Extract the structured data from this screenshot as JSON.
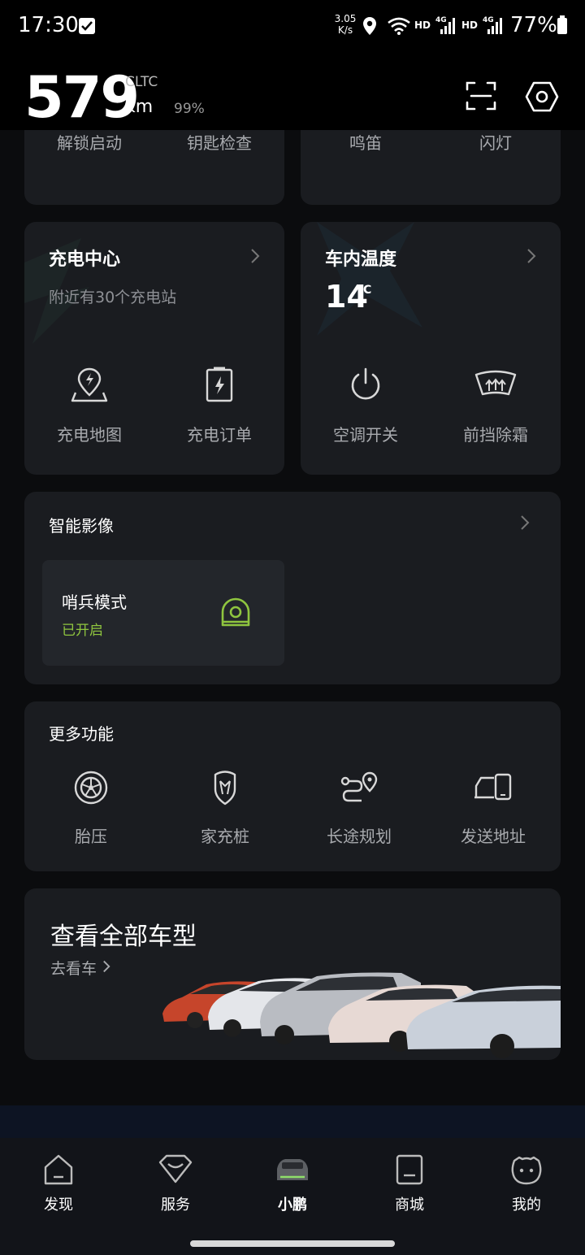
{
  "status": {
    "time": "17:30",
    "net_speed_value": "3.05",
    "net_speed_unit": "K/s",
    "hd_1": "HD",
    "net_1": "4G",
    "hd_2": "HD",
    "net_2": "4G",
    "battery": "77%"
  },
  "header": {
    "range_value": "579",
    "range_standard": "CLTC",
    "range_unit": "km",
    "battery_percent": "99%"
  },
  "quick_controls": {
    "left": [
      "解锁启动",
      "钥匙检查"
    ],
    "right": [
      "鸣笛",
      "闪灯"
    ]
  },
  "charging": {
    "title": "充电中心",
    "subtitle": "附近有30个充电站",
    "actions": [
      "充电地图",
      "充电订单"
    ]
  },
  "climate": {
    "title": "车内温度",
    "temp_value": "14",
    "temp_unit": "°C",
    "actions": [
      "空调开关",
      "前挡除霜"
    ]
  },
  "smart_camera": {
    "title": "智能影像",
    "sentry_title": "哨兵模式",
    "sentry_status": "已开启"
  },
  "more": {
    "title": "更多功能",
    "items": [
      "胎压",
      "家充桩",
      "长途规划",
      "发送地址"
    ]
  },
  "models": {
    "title": "查看全部车型",
    "link": "去看车"
  },
  "tabs": [
    "发现",
    "服务",
    "小鹏",
    "商城",
    "我的"
  ],
  "colors": {
    "background": "#000000",
    "card": "#1a1c20",
    "accent_green": "#8fc53f",
    "label_gray": "#a8aaae"
  }
}
